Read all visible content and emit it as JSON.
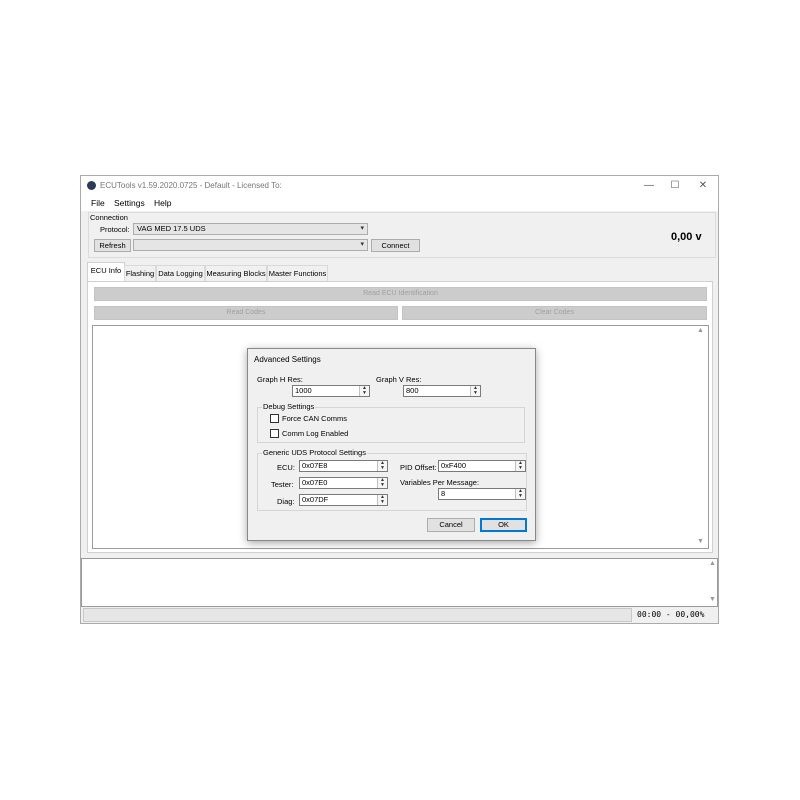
{
  "window": {
    "title": "ECUTools v1.59.2020.0725 - Default - Licensed To:",
    "minimize": "—",
    "maximize": "☐",
    "close": "✕"
  },
  "menu": [
    "File",
    "Settings",
    "Help"
  ],
  "connection": {
    "group_label": "Connection",
    "protocol_label": "Protocol:",
    "protocol_value": "VAG MED 17.5 UDS",
    "refresh_label": "Refresh",
    "port_value": "",
    "connect_label": "Connect",
    "voltage": "0,00 v"
  },
  "tabs": [
    "ECU Info",
    "Flashing",
    "Data Logging",
    "Measuring Blocks",
    "Master Functions"
  ],
  "ecu_info": {
    "read_ecu_label": "Read ECU Identification",
    "read_codes_label": "Read Codes",
    "clear_codes_label": "Clear Codes"
  },
  "dialog": {
    "title": "Advanced Settings",
    "graph_h_label": "Graph H Res:",
    "graph_h_value": "1000",
    "graph_v_label": "Graph V Res:",
    "graph_v_value": "800",
    "debug_group": "Debug Settings",
    "force_can_label": "Force CAN Comms",
    "comm_log_label": "Comm Log Enabled",
    "uds_group": "Generic UDS Protocol Settings",
    "ecu_label": "ECU:",
    "ecu_value": "0x07E8",
    "tester_label": "Tester:",
    "tester_value": "0x07E0",
    "diag_label": "Diag:",
    "diag_value": "0x07DF",
    "pid_offset_label": "PID Offset:",
    "pid_offset_value": "0xF400",
    "vars_per_msg_label": "Variables Per Message:",
    "vars_per_msg_value": "8",
    "cancel_label": "Cancel",
    "ok_label": "OK"
  },
  "status": {
    "timer": "00:00 - 00,00%"
  },
  "icons": {
    "app": "ecutools-logo-icon",
    "scroll_up": "▲",
    "scroll_down": "▼",
    "spin_up": "▲",
    "spin_down": "▼",
    "dropdown": "▾"
  }
}
